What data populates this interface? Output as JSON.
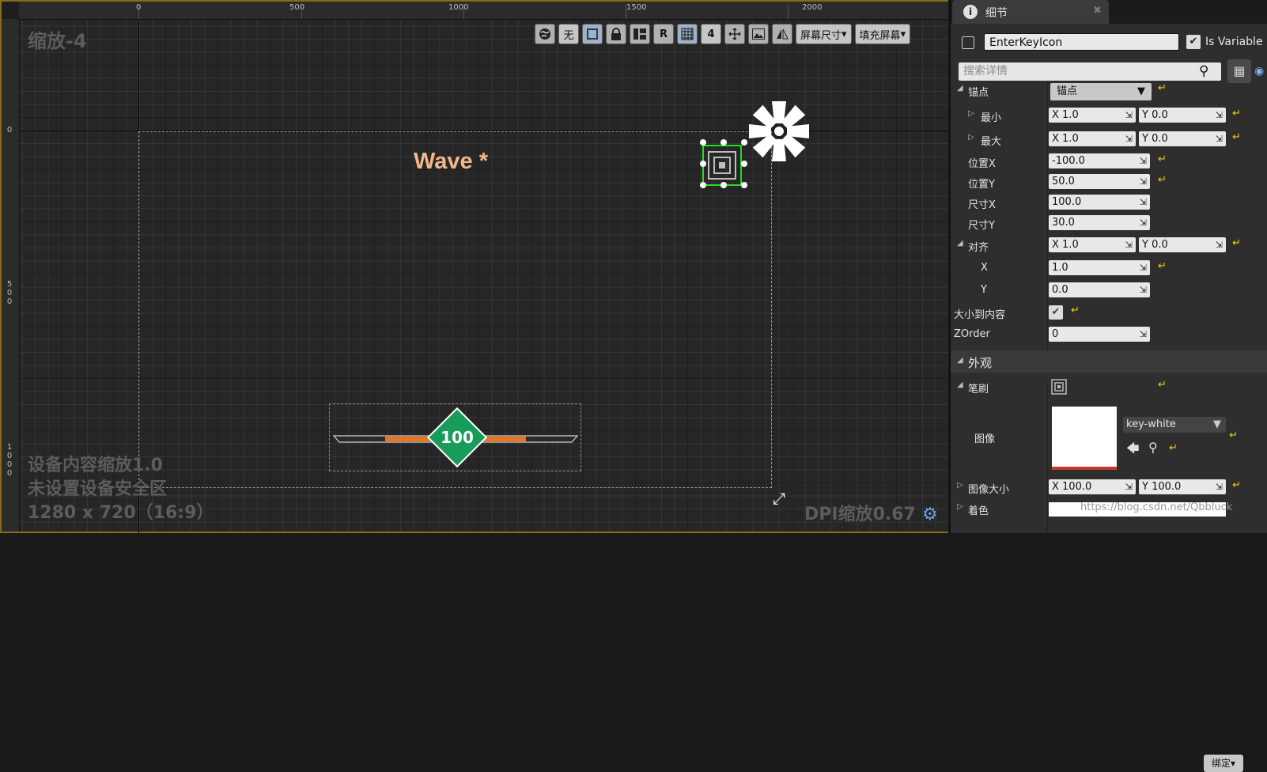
{
  "designer": {
    "zoom_label": "缩放-4",
    "ruler_x_ticks": [
      "0",
      "500",
      "1000",
      "1500",
      "2000"
    ],
    "ruler_y_ticks": [
      "0",
      "500",
      "1000"
    ],
    "wave_text": "Wave *",
    "healthbar_value": "100",
    "info_line_1": "设备内容缩放1.0",
    "info_line_2": "未设置设备安全区",
    "info_line_3": "1280 x 720（16:9）",
    "dpi_label": "DPI缩放0.67",
    "toolbar": {
      "globe_icon": "globe-icon",
      "none_option": "无",
      "rotate_label": "R",
      "grid_snap_value": "4",
      "screen_size_label": "屏幕尺寸",
      "fill_screen_label": "填充屏幕"
    },
    "colors": {
      "wave": "#f3b68a",
      "healthbar_orange": "#e8741c",
      "healthbar_green": "#189c5a",
      "selection": "#1ee21e",
      "canvas_bg": "#262626"
    }
  },
  "details": {
    "tab_title": "细节",
    "widget_name": "EnterKeyIcon",
    "is_variable_label": "Is Variable",
    "search_placeholder": "搜索详情",
    "anchors": {
      "label": "锚点",
      "dropdown": "锚点",
      "min": {
        "label": "最小",
        "x": "X  1.0",
        "y": "Y  0.0"
      },
      "max": {
        "label": "最大",
        "x": "X  1.0",
        "y": "Y  0.0"
      }
    },
    "position_x": {
      "label": "位置X",
      "value": "-100.0"
    },
    "position_y": {
      "label": "位置Y",
      "value": "50.0"
    },
    "size_x": {
      "label": "尺寸X",
      "value": "100.0"
    },
    "size_y": {
      "label": "尺寸Y",
      "value": "30.0"
    },
    "alignment": {
      "label": "对齐",
      "x": "X  1.0",
      "y": "Y  0.0",
      "x_label": "X",
      "x_value": "1.0",
      "y_label": "Y",
      "y_value": "0.0"
    },
    "size_to_content": {
      "label": "大小到内容",
      "checked": true
    },
    "zorder": {
      "label": "ZOrder",
      "value": "0"
    },
    "appearance": {
      "label": "外观",
      "brush_label": "笔刷",
      "bind_label": "绑定",
      "image_label": "图像",
      "image_asset": "key-white",
      "image_size": {
        "label": "图像大小",
        "x": "X  100.0",
        "y": "Y  100.0"
      },
      "tint_label": "着色"
    },
    "watermark": "https://blog.csdn.net/Qbbluck"
  }
}
